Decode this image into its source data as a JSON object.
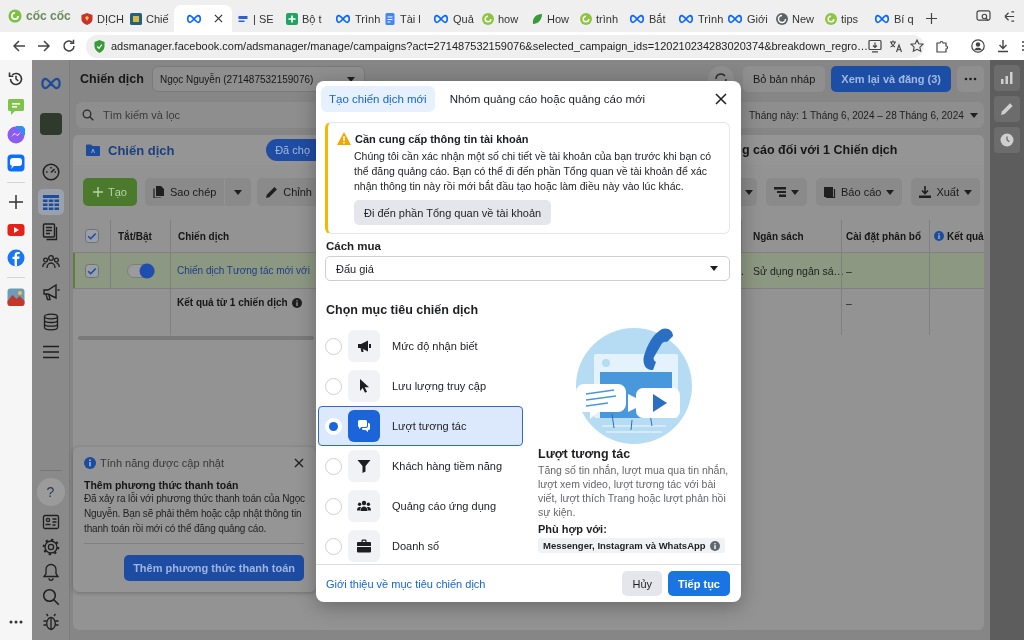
{
  "browser": {
    "brand": "cốc cốc",
    "tabs": [
      {
        "kind": "shield",
        "label": "DỊCH",
        "selected": false
      },
      {
        "kind": "photo",
        "label": "Chiế",
        "selected": false
      },
      {
        "kind": "meta",
        "selected": true
      },
      {
        "kind": "seo",
        "label": "| SE",
        "selected": false
      },
      {
        "kind": "sheet",
        "label": "Bộ t",
        "selected": false
      },
      {
        "kind": "meta",
        "label": "Trình",
        "selected": false
      },
      {
        "kind": "docs",
        "label": "Tài l",
        "selected": false
      },
      {
        "kind": "meta",
        "label": "Quả",
        "selected": false
      },
      {
        "kind": "swirl",
        "label": "how",
        "selected": false
      },
      {
        "kind": "leaf",
        "label": "How",
        "selected": false
      },
      {
        "kind": "swirl",
        "label": "trình",
        "selected": false
      },
      {
        "kind": "meta",
        "label": "Bắt",
        "selected": false
      },
      {
        "kind": "meta",
        "label": "Trình",
        "selected": false
      },
      {
        "kind": "meta",
        "label": "Giới",
        "selected": false
      },
      {
        "kind": "globe",
        "label": "New",
        "selected": false
      },
      {
        "kind": "swirl",
        "label": "tips",
        "selected": false
      },
      {
        "kind": "meta",
        "label": "Bí q",
        "selected": false
      }
    ],
    "url": "adsmanager.facebook.com/adsmanager/manage/campaigns?act=271487532159076&selected_campaign_ids=120210234283020374&breakdown_regro…"
  },
  "ads": {
    "title": "Chiến dịch",
    "account": "Ngọc Nguyễn (271487532159076)",
    "nav": [
      {
        "kind": "gauge",
        "selected": false
      },
      {
        "kind": "table",
        "selected": true
      },
      {
        "kind": "pages",
        "selected": false
      },
      {
        "kind": "people",
        "selected": false
      },
      {
        "kind": "megaphone",
        "selected": false
      },
      {
        "kind": "coins",
        "selected": false
      },
      {
        "kind": "menu",
        "selected": false
      }
    ],
    "help_label": "?",
    "header_buttons": [
      {
        "kind": "secondary",
        "label": "Bỏ bản nháp"
      },
      {
        "kind": "primary",
        "label": "Xem lại và đăng (3)"
      }
    ],
    "search": {
      "placeholder": "Tìm kiếm và lọc"
    },
    "date_range": "Tháng này: 1 Tháng 6, 2024 – 28 Tháng 6, 2024",
    "section": {
      "title": "Chiến dịch",
      "badge": "Đã chọ",
      "summary": "g cáo đối với 1 Chiến dịch"
    },
    "toolbar_left": [
      {
        "kind": "create",
        "label": "Tạo"
      },
      {
        "kind": "split",
        "label": "Sao chép"
      },
      {
        "kind": "edit",
        "label": "Chỉnh"
      }
    ],
    "toolbar_right": [
      {
        "kind": "caret"
      },
      {
        "kind": "columns"
      },
      {
        "kind": "report",
        "label": "Báo cáo"
      },
      {
        "kind": "export",
        "label": "Xuất"
      }
    ],
    "table": {
      "all_checked": true,
      "columns_left": [
        "Tắt/Bật",
        "Chiến dịch"
      ],
      "columns_right": [
        {
          "label": "Ngân sách",
          "info": false
        },
        {
          "label": "Cài đặt phân bổ",
          "info": false
        },
        {
          "label": "Kết quả",
          "info": true
        }
      ],
      "rows": [
        {
          "selected": true,
          "checked": true,
          "on": true,
          "name": "Chiến dịch Tương tác mới với",
          "cut_cell": ".",
          "budget": "Sử dụng ngân sá…",
          "allocation": "–"
        }
      ],
      "total": {
        "label": "Kết quả từ 1 chiến dịch",
        "info": true,
        "allocation": "–"
      }
    },
    "notice": {
      "title": "Tính năng được cập nhật",
      "heading": "Thêm phương thức thanh toán",
      "body": "Đã xảy ra lỗi với phương thức thanh toán của Ngọc Nguyễn. Bạn sẽ phải thêm hoặc cập nhật thông tin thanh toán rồi mới có thể đăng quảng cáo.",
      "button": "Thêm phương thức thanh toán"
    }
  },
  "modal": {
    "tabs": [
      {
        "label": "Tạo chiến dịch mới",
        "selected": true
      },
      {
        "label": "Nhóm quảng cáo hoặc quảng cáo mới",
        "selected": false
      }
    ],
    "alert": {
      "title": "Cần cung cấp thông tin tài khoản",
      "body": "Chúng tôi cần xác nhận một số chi tiết về tài khoản của bạn trước khi bạn có thể đăng quảng cáo. Bạn có thể đi đến phần Tổng quan về tài khoản để xác nhận thông tin này rồi mới bắt đầu tạo hoặc làm điều này vào lúc khác.",
      "button": "Đi đến phần Tổng quan về tài khoản"
    },
    "buying_type": {
      "label": "Cách mua",
      "value": "Đấu giá"
    },
    "objective_heading": "Chọn mục tiêu chiến dịch",
    "objectives": [
      {
        "kind": "awareness",
        "label": "Mức độ nhận biết",
        "selected": false
      },
      {
        "kind": "traffic",
        "label": "Lưu lượng truy cập",
        "selected": false
      },
      {
        "kind": "engagement",
        "label": "Lượt tương tác",
        "selected": true
      },
      {
        "kind": "leads",
        "label": "Khách hàng tiềm năng",
        "selected": false
      },
      {
        "kind": "app",
        "label": "Quảng cáo ứng dụng",
        "selected": false
      },
      {
        "kind": "sales",
        "label": "Doanh số",
        "selected": false
      }
    ],
    "detail": {
      "title": "Lượt tương tác",
      "description": "Tăng số tin nhắn, lượt mua qua tin nhắn, lượt xem video, lượt tương tác với bài viết, lượt thích Trang hoặc lượt phản hồi sự kiện.",
      "fit_label": "Phù hợp với:",
      "fit_value": "Messenger, Instagram và WhatsApp"
    },
    "footer": {
      "link": "Giới thiệu về mục tiêu chiến dịch",
      "buttons": [
        {
          "kind": "secondary",
          "label": "Hủy"
        },
        {
          "kind": "primary",
          "label": "Tiếp tục"
        }
      ]
    }
  }
}
